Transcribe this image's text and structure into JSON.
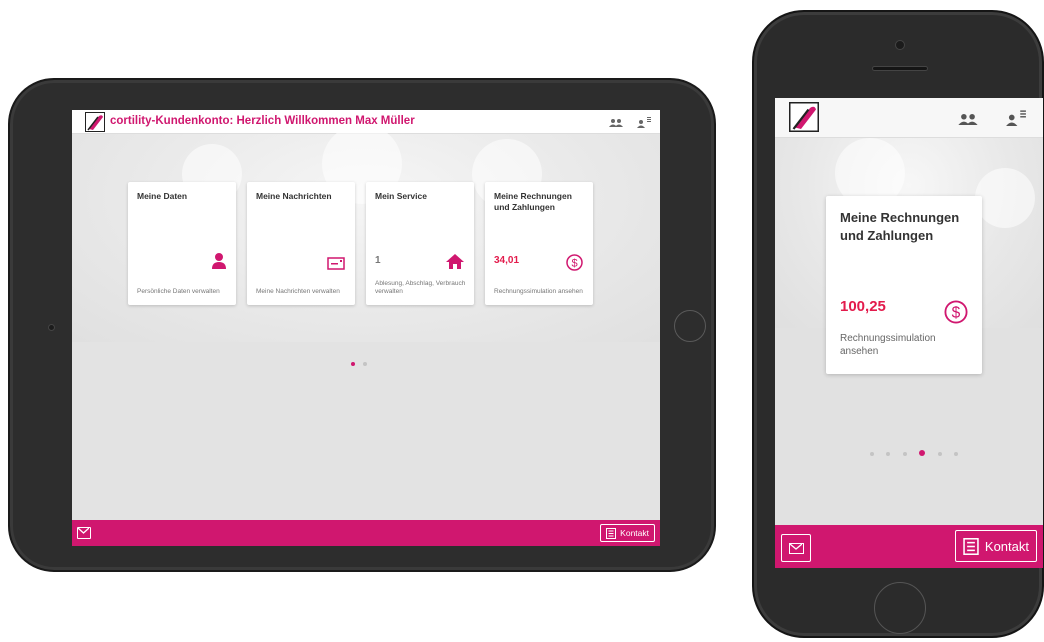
{
  "tablet": {
    "header": {
      "title": "cortility-Kundenkonto: Herzlich Willkommen Max Müller"
    },
    "cards": [
      {
        "title": "Meine Daten",
        "value": "",
        "desc": "Persönliche Daten verwalten",
        "icon": "person-icon"
      },
      {
        "title": "Meine Nachrichten",
        "value": "",
        "desc": "Meine Nachrichten verwalten",
        "icon": "message-icon"
      },
      {
        "title": "Mein Service",
        "value": "1",
        "desc": "Ablesung, Abschlag, Verbrauch verwalten",
        "icon": "house-icon"
      },
      {
        "title": "Meine Rechnungen und Zahlungen",
        "value": "34,01",
        "desc": "Rechnungssimulation ansehen",
        "icon": "dollar-icon"
      }
    ],
    "pagination": {
      "total": 2,
      "active": 0
    },
    "footer": {
      "contact_label": "Kontakt"
    }
  },
  "phone": {
    "card": {
      "title": "Meine Rechnungen und Zahlungen",
      "value": "100,25",
      "desc": "Rechnungssimulation ansehen",
      "icon": "dollar-icon"
    },
    "pagination": {
      "total": 6,
      "active": 3
    },
    "footer": {
      "contact_label": "Kontakt"
    }
  },
  "colors": {
    "brand": "#d0176f",
    "value_red": "#e31b4c"
  }
}
